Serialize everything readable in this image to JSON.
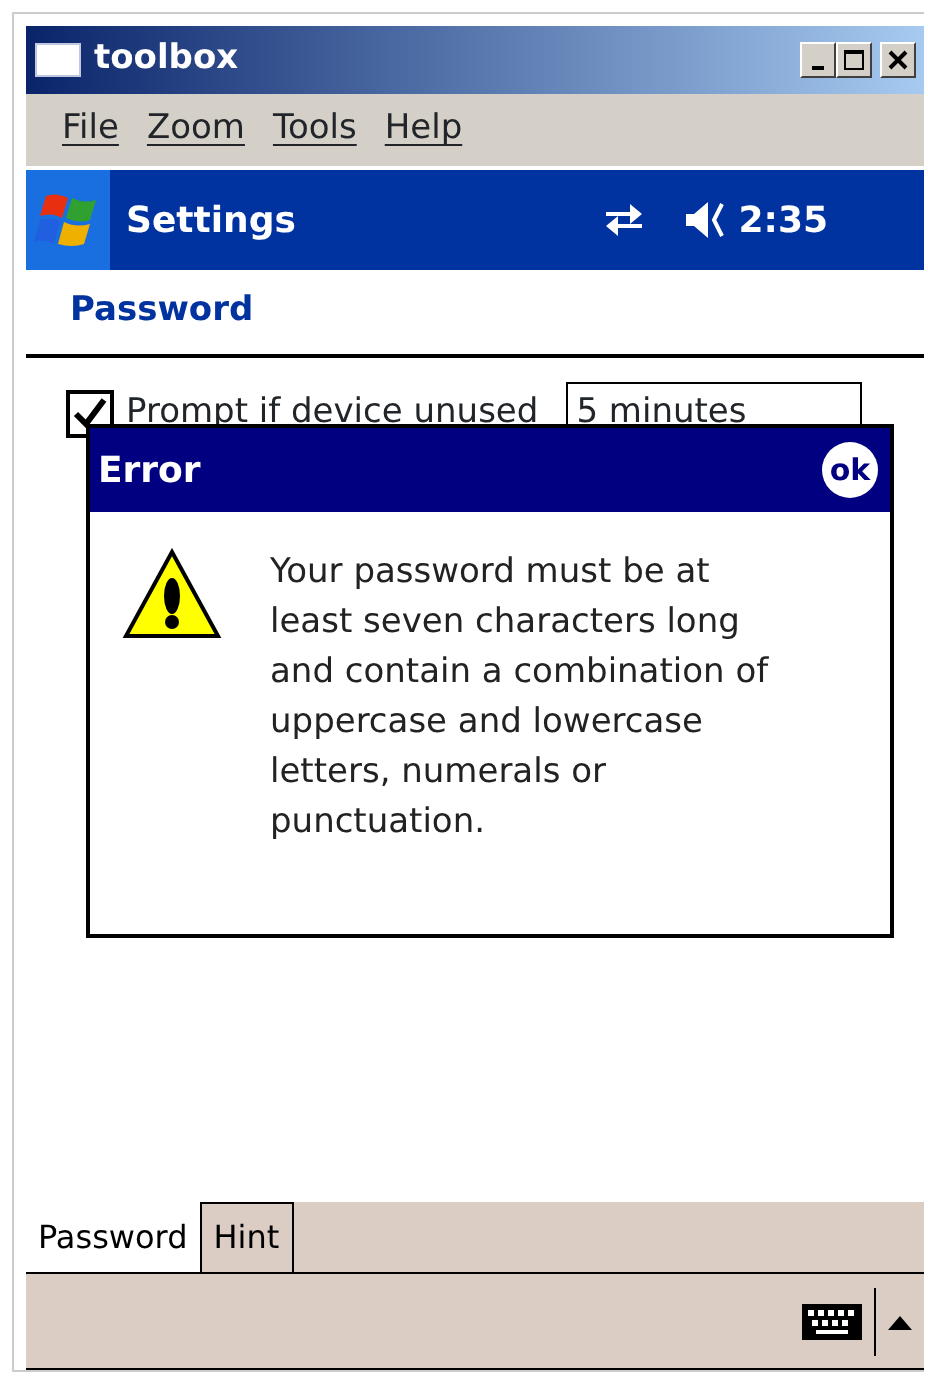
{
  "window": {
    "title": "toolbox"
  },
  "menu": [
    "File",
    "Zoom",
    "Tools",
    "Help"
  ],
  "nav_bar": {
    "title": "Settings",
    "time": "2:35"
  },
  "page_title": "Password",
  "prompt": {
    "label": "Prompt if device unused",
    "checked": true,
    "value": "5 minutes"
  },
  "dialog": {
    "title": "Error",
    "ok": "ok",
    "message": "Your password must be at least seven characters long and contain a combination of uppercase and lowercase letters, numerals or punctuation."
  },
  "tabs": [
    {
      "label": "Password",
      "selected": true
    },
    {
      "label": "Hint",
      "selected": false
    }
  ]
}
